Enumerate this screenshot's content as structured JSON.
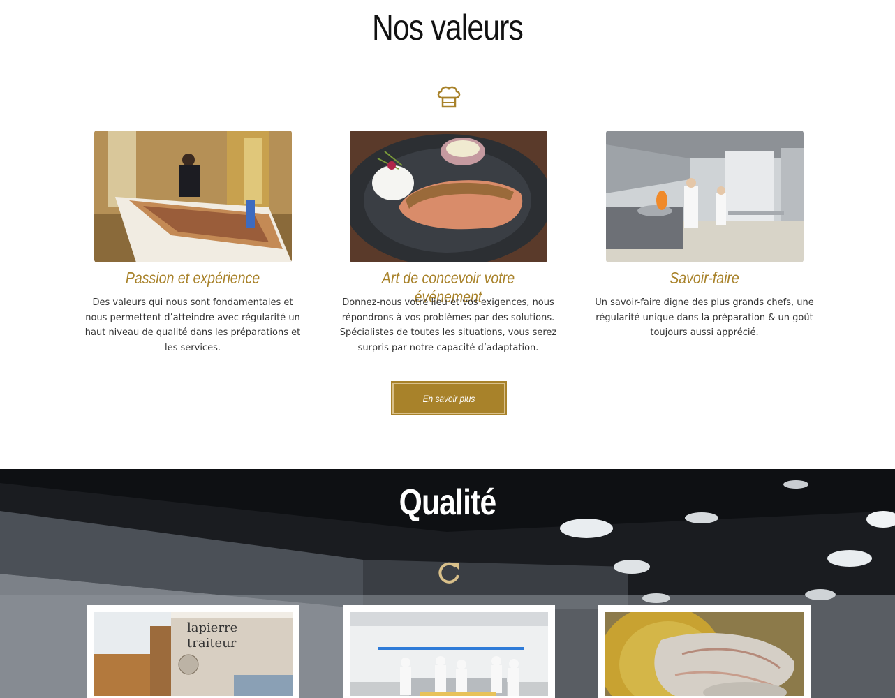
{
  "values_section": {
    "title": "Nos valeurs",
    "divider_icon": "chef-hat-icon",
    "cards": [
      {
        "title": "Passion et expérience",
        "text": "Des valeurs qui nous sont fondamentales et nous permettent d’atteindre avec régularité un haut niveau de qualité dans les préparations et les services.",
        "image": "buffet-photo"
      },
      {
        "title": "Art de concevoir votre événement",
        "text": "Donnez-nous votre lieu et vos exigences, nous répondrons à vos problèmes par des solutions. Spécialistes de toutes les situations, vous serez surpris par notre capacité d’adaptation.",
        "image": "salmon-dish-photo"
      },
      {
        "title": "Savoir-faire",
        "text": "Un savoir-faire digne des plus grands chefs, une régularité unique dans la préparation & un goût toujours aussi apprécié.",
        "image": "kitchen-photo"
      }
    ],
    "button_label": "En savoir plus"
  },
  "quality_section": {
    "title": "Qualité",
    "divider_icon": "refresh-icon",
    "cards": [
      {
        "image": "building-photo",
        "sign_line1": "lapierre",
        "sign_line2": "traiteur"
      },
      {
        "image": "chefs-team-photo"
      },
      {
        "image": "marinated-fish-photo"
      }
    ]
  },
  "colors": {
    "accent": "#a8822a",
    "title": "#111111",
    "text": "#333333"
  }
}
